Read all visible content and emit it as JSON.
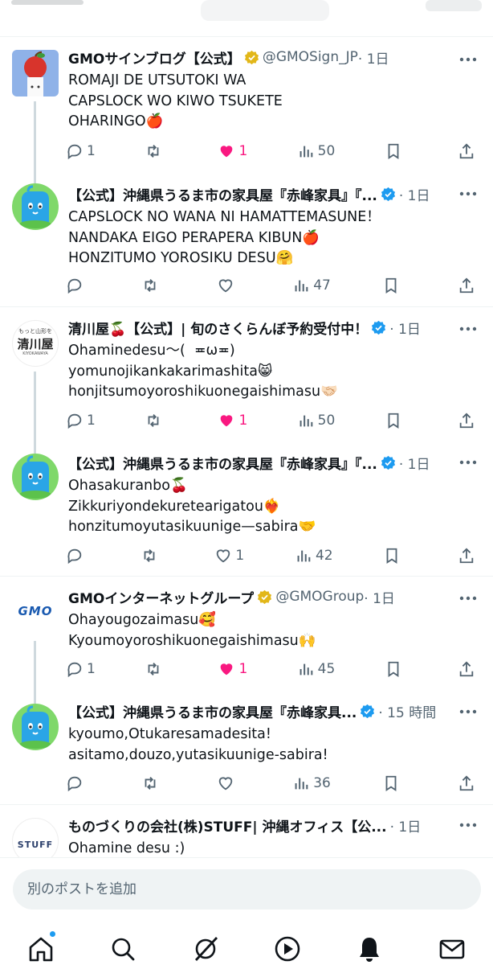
{
  "posts": [
    {
      "name": "GMOサインブログ【公式】",
      "badge": "gold",
      "handle": "@GMOSign_JP",
      "time": "· 1日",
      "text": "ROMAJI DE UTSUTOKI WA\nCAPSLOCK WO KIWO TSUKETE\nOHARINGO🍎",
      "replies": "1",
      "retweets": "",
      "likes": "1",
      "liked": true,
      "views": "50",
      "avatar": "apple-mascot"
    },
    {
      "name": "【公式】沖縄県うるま市の家具屋『赤峰家具』『...",
      "badge": "blue",
      "handle": "",
      "time": "· 1日",
      "text": "CAPSLOCK NO WANA NI HAMATTEMASUNE！\nNANDAKA EIGO PERAPERA KIBUN🍎\nHONZITUMO YOROSIKU DESU🤗",
      "replies": "",
      "retweets": "",
      "likes": "",
      "liked": false,
      "views": "47",
      "avatar": "akamine-mascot"
    },
    {
      "name": "清川屋🍒【公式】| 旬のさくらんぼ予約受付中！",
      "badge": "blue",
      "handle": "",
      "time": "· 1日",
      "text": "Ohaminedesu〜(  ≖ω≖)\nyomunojikankakarimashita😸\nhonjitsumoyoroshikuonegaishimasu🤝🏻",
      "replies": "1",
      "retweets": "",
      "likes": "1",
      "liked": true,
      "views": "50",
      "avatar": "kiyokawaya-logo",
      "avatar_top": "もっと山形を",
      "avatar_main": "清川屋",
      "avatar_sub": "KIYOKAWAYA"
    },
    {
      "name": "【公式】沖縄県うるま市の家具屋『赤峰家具』『...",
      "badge": "blue",
      "handle": "",
      "time": "· 1日",
      "text": "Ohasakuranbo🍒\nZikkuriyondekuretearigatou❤️‍🔥\nhonzitumoyutasikuunige—sabira🤝",
      "replies": "",
      "retweets": "",
      "likes": "1",
      "liked": false,
      "views": "42",
      "avatar": "akamine-mascot"
    },
    {
      "name": "GMOインターネットグループ",
      "badge": "gold",
      "handle": "@GMOGroup",
      "time": "· 1日",
      "text": "Ohayougozaimasu🥰\nKyoumoyoroshikuonegaishimasu🙌",
      "replies": "1",
      "retweets": "",
      "likes": "1",
      "liked": true,
      "views": "45",
      "avatar": "gmo-logo",
      "avatar_main": "GMO"
    },
    {
      "name": "【公式】沖縄県うるま市の家具屋『赤峰家具...",
      "badge": "blue",
      "handle": "",
      "time": "· 15 時間",
      "text": "kyoumo,Otukaresamadesita!\nasitamo,douzo,yutasikuunige-sabira!",
      "replies": "",
      "retweets": "",
      "likes": "",
      "liked": false,
      "views": "36",
      "avatar": "akamine-mascot"
    },
    {
      "name": "ものづくりの会社(株)STUFF| 沖縄オフィス【公...",
      "badge": "",
      "handle": "",
      "time": "· 1日",
      "text": "Ohamine desu :)",
      "avatar": "stuff-logo",
      "avatar_main": "STUFF"
    }
  ],
  "composer": {
    "placeholder": "別のポストを追加"
  },
  "tabs": [
    "home-icon",
    "search-icon",
    "grok-icon",
    "video-icon",
    "notifications-icon",
    "messages-icon"
  ],
  "colors": {
    "like": "#f91880",
    "muted": "#536471",
    "verified_blue": "#1d9bf0",
    "verified_gold": "#e2b719",
    "thread_line": "#cfd9de"
  }
}
